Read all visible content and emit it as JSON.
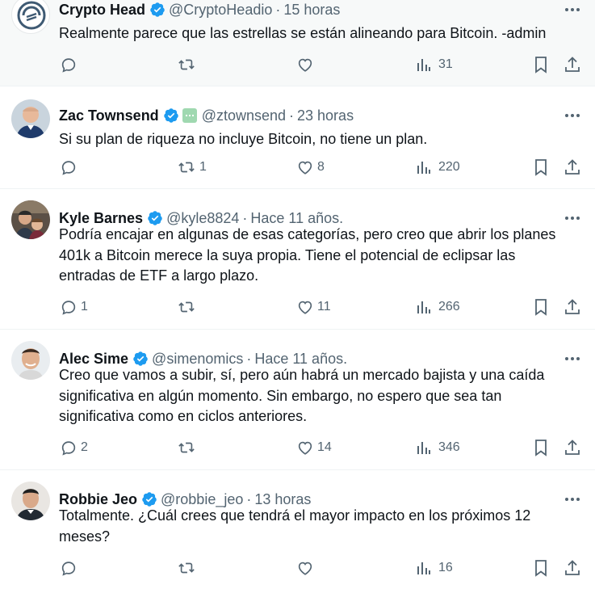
{
  "tweets": [
    {
      "name": "Crypto Head",
      "handle": "@CryptoHeadio",
      "time": "15 horas",
      "text": "Realmente parece que las estrellas se están alineando para Bitcoin. -admin",
      "replies": "",
      "retweets": "",
      "likes": "",
      "views": "31",
      "avatar": "crypto-head-logo"
    },
    {
      "name": "Zac Townsend",
      "handle": "@ztownsend",
      "time": "23 horas",
      "text": "Si su plan de riqueza no incluye Bitcoin, no tiene un plan.",
      "replies": "",
      "retweets": "1",
      "likes": "8",
      "views": "220",
      "avatar": "zac-photo"
    },
    {
      "name": "Kyle Barnes",
      "handle": "@kyle8824",
      "time": "Hace 11 años.",
      "text": "Podría encajar en algunas de esas categorías, pero creo que abrir los planes 401k a Bitcoin merece la suya propia. Tiene el potencial de eclipsar las entradas de ETF a largo plazo.",
      "replies": "1",
      "retweets": "",
      "likes": "11",
      "views": "266",
      "avatar": "kyle-photo"
    },
    {
      "name": "Alec Sime",
      "handle": "@simenomics",
      "time": "Hace 11 años.",
      "text": "Creo que vamos a subir, sí, pero aún habrá un mercado bajista y una caída significativa en algún momento. Sin embargo, no espero que sea tan significativa como en ciclos anteriores.",
      "replies": "2",
      "retweets": "",
      "likes": "14",
      "views": "346",
      "avatar": "alec-photo"
    },
    {
      "name": "Robbie Jeo",
      "handle": "@robbie_jeo",
      "time": "13 horas",
      "text": "Totalmente. ¿Cuál crees que tendrá el mayor impacto en los próximos 12 meses?",
      "replies": "",
      "retweets": "",
      "likes": "",
      "views": "16",
      "avatar": "robbie-photo"
    }
  ],
  "colors": {
    "verified": "#1d9bf0",
    "secondary_text": "#536471",
    "primary_text": "#0f1419",
    "highlight_bg": "#f7f9f9",
    "divider": "#eff3f4"
  }
}
